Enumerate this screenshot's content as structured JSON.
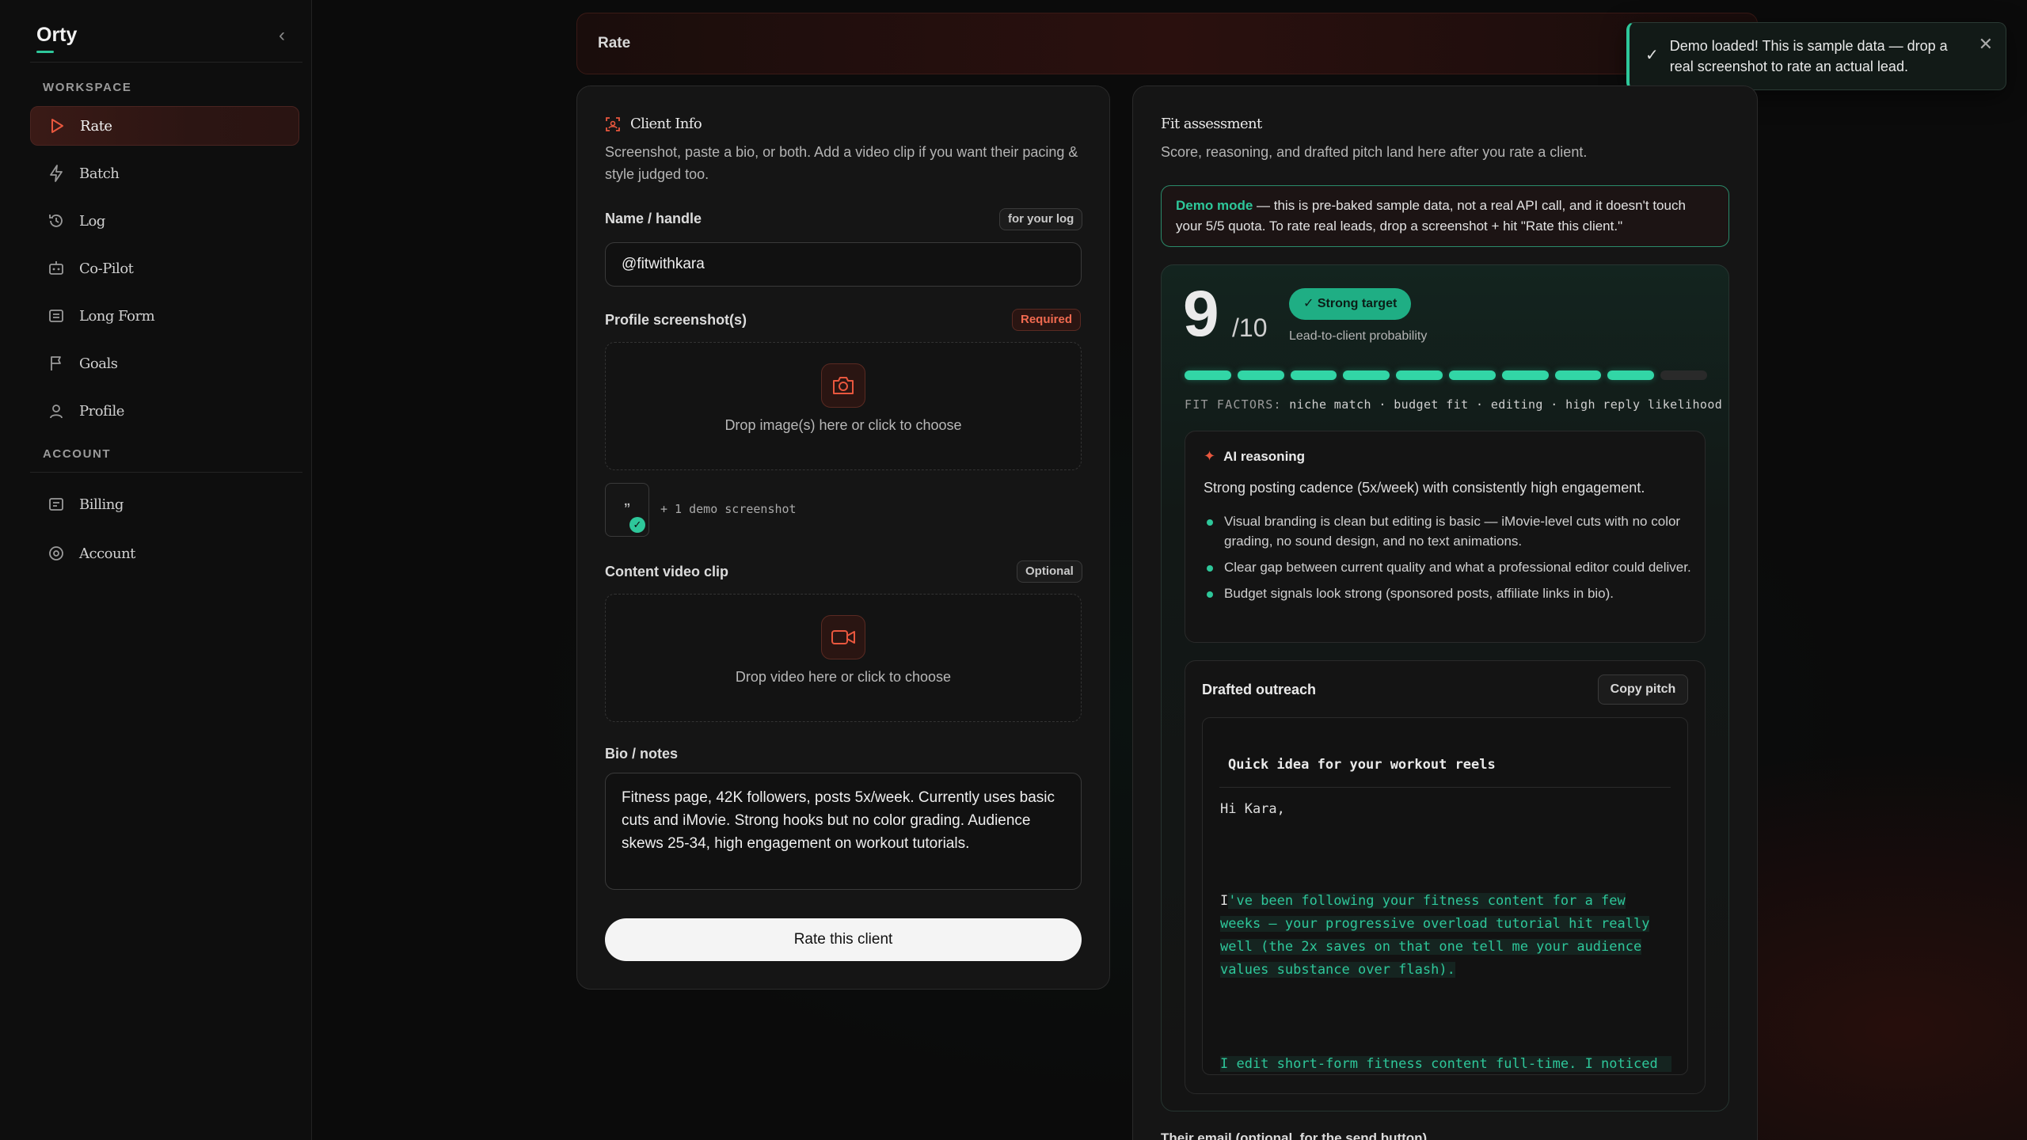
{
  "app": {
    "brand": "Orty"
  },
  "sidebar": {
    "workspace_label": "WORKSPACE",
    "account_label": "ACCOUNT",
    "items": [
      {
        "label": "Rate",
        "icon": "play-icon",
        "active": true
      },
      {
        "label": "Batch",
        "icon": "bolt-icon"
      },
      {
        "label": "Log",
        "icon": "history-icon"
      },
      {
        "label": "Co-Pilot",
        "icon": "robot-icon"
      },
      {
        "label": "Long Form",
        "icon": "document-icon"
      },
      {
        "label": "Goals",
        "icon": "flag-icon"
      },
      {
        "label": "Profile",
        "icon": "user-icon"
      }
    ],
    "account_items": [
      {
        "label": "Billing",
        "icon": "receipt-icon"
      },
      {
        "label": "Account",
        "icon": "at-icon"
      }
    ]
  },
  "topbar": {
    "title": "Rate"
  },
  "toast": {
    "message": "Demo loaded! This is sample data — drop a real screenshot to rate an actual lead."
  },
  "client_info": {
    "title": "Client Info",
    "description": "Screenshot, paste a bio, or both. Add a video clip if you want their pacing & style judged too.",
    "name_label": "Name / handle",
    "name_tag": "for your log",
    "name_value": "@fitwithkara",
    "screenshot_label": "Profile screenshot(s)",
    "screenshot_tag": "Required",
    "screenshot_drop": "Drop image(s) here or click to choose",
    "thumb_glyph": "„",
    "demo_screenshot": "+ 1 demo screenshot",
    "video_label": "Content video clip",
    "video_tag": "Optional",
    "video_drop": "Drop video here or click to choose",
    "bio_label": "Bio / notes",
    "bio_value": "Fitness page, 42K followers, posts 5x/week. Currently uses basic cuts and iMovie. Strong hooks but no color grading. Audience skews 25-34, high engagement on workout tutorials.",
    "rate_button": "Rate this client"
  },
  "fit": {
    "title": "Fit assessment",
    "description": "Score, reasoning, and drafted pitch land here after you rate a client.",
    "demo_mode_label": "Demo mode",
    "demo_mode_text": " — this is pre-baked sample data, not a real API call, and it doesn't touch your 5/5 quota. To rate real leads, drop a screenshot + hit \"Rate this client.\"",
    "score": "9",
    "score_of": "/10",
    "badge": "✓ Strong target",
    "probability_label": "Lead-to-client probability",
    "score_value": 9,
    "score_max": 10,
    "factors_label": "FIT FACTORS:",
    "factors": "niche match · budget fit · editing · high reply likelihood",
    "accent_color": "#2ec79a",
    "brand_red": "#e8573e"
  },
  "reasoning": {
    "title": "AI reasoning",
    "lead": "Strong posting cadence (5x/week) with consistently high engagement.",
    "bullets": [
      "Visual branding is clean but editing is basic — iMovie-level cuts with no color grading, no sound design, and no text animations.",
      "Clear gap between current quality and what a professional editor could deliver.",
      "Budget signals look strong (sponsored posts, affiliate links in bio)."
    ]
  },
  "outreach": {
    "title": "Drafted outreach",
    "copy_button": "Copy pitch",
    "subject": "Quick idea for your workout reels",
    "greeting": "Hi Kara,",
    "para1_lead": "I",
    "para1": "'ve been following your fitness content for a few weeks — your progressive overload tutorial hit really well (the  2x saves on that one tell me your audience values substance over flash).",
    "para2": "I edit short-form fitness content full-time. I noticed"
  },
  "email": {
    "label": "Their email (optional, for the send button)"
  }
}
